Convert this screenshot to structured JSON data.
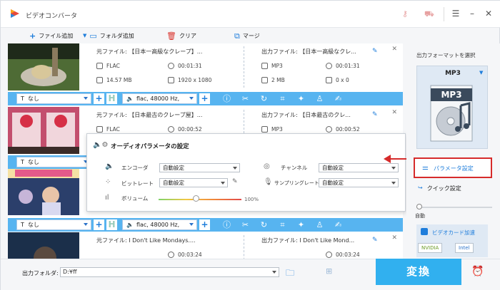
{
  "app": {
    "title": "ビデオコンバータ"
  },
  "toolbar": {
    "add_file": "ファイル追加",
    "add_folder": "フォルダ追加",
    "clear": "クリア",
    "merge": "マージ"
  },
  "items": [
    {
      "src_title": "元ファイル: 【日本一高級なクレープ】...",
      "src_format": "FLAC",
      "src_duration": "00:01:31",
      "src_size": "14.57 MB",
      "src_resolution": "1920 x 1080",
      "out_title": "出力ファイル: 【日本一高級なクレ...",
      "out_format": "MP3",
      "out_duration": "00:01:31",
      "out_size": "2 MB",
      "out_resolution": "0 x 0"
    },
    {
      "src_title": "元ファイル: 【日本最古のクレープ屋】...",
      "src_format": "FLAC",
      "src_duration": "00:00:52",
      "out_title": "出力ファイル: 【日本最古のクレ...",
      "out_format": "MP3",
      "out_duration": "00:00:52"
    },
    {
      "src_title": "元ファイル: I Don't Like Mondays....",
      "src_duration": "00:03:24",
      "out_title": "出力ファイル: I Don't Like Mond...",
      "out_duration": "00:03:24"
    }
  ],
  "ctrlbar": {
    "subtitle": "なし",
    "audio": "flac, 48000 Hz,",
    "audio2": "flac, 48000 Hz,"
  },
  "popup": {
    "title": "オーディオパラメータの設定",
    "encoder_label": "エンコーダ",
    "encoder_value": "自動設定",
    "bitrate_label": "ビットレート",
    "bitrate_value": "自動設定",
    "volume_label": "ボリューム",
    "volume_value": "100%",
    "volume_level": 0.45,
    "channel_label": "チャンネル",
    "channel_value": "自動設定",
    "samplerate_label": "サンプリングレート",
    "samplerate_value": "自動設定"
  },
  "right": {
    "select_format": "出力フォーマットを選択",
    "format": "MP3",
    "format_badge": "MP3",
    "param_settings": "パラメータ設定",
    "quick_settings": "クイック設定",
    "auto": "自動",
    "gpu": "ビデオカード加速",
    "nvidia": "NVIDIA",
    "intel": "Intel"
  },
  "bottom": {
    "output_folder_label": "出力フォルダ:",
    "output_folder_value": "D:¥ff",
    "convert": "変換"
  },
  "colors": {
    "accent": "#31b0ef",
    "ctrlbar": "#57b4f0",
    "highlight": "#d62b2b"
  }
}
